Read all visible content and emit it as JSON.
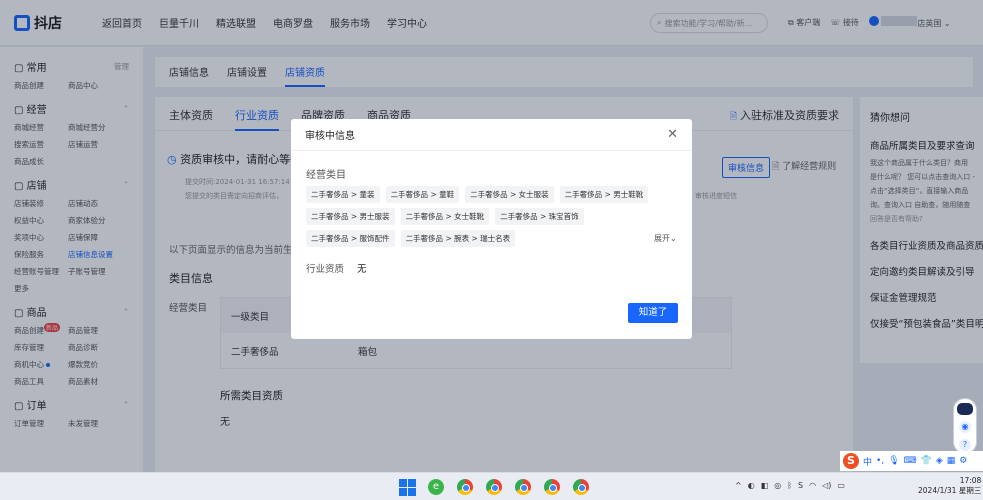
{
  "topbar": {
    "logo": "抖店",
    "nav": [
      "返回首页",
      "巨量千川",
      "精选联盟",
      "电商罗盘",
      "服务市场",
      "学习中心"
    ],
    "search_placeholder": "搜索功能/学习/帮助/新...",
    "service": "客户端",
    "help": "接待",
    "user_suffix": "店英国"
  },
  "sidebar": {
    "groups": [
      {
        "title": "常用",
        "extra": "管理",
        "items": [
          "商品创建",
          "商品中心"
        ]
      },
      {
        "title": "经营",
        "extra": "",
        "items": [
          "商城经营",
          "商城经营分",
          "搜索运营",
          "店铺运营",
          "商品成长",
          ""
        ]
      },
      {
        "title": "店铺",
        "extra": "",
        "items": [
          "店铺装修",
          "店铺动态",
          "权益中心",
          "商家体验分",
          "奖项中心",
          "店铺保障",
          "保险服务",
          "店铺信息设置",
          "经营账号管理",
          "子账号管理",
          "更多",
          ""
        ]
      },
      {
        "title": "商品",
        "extra": "",
        "items": [
          "商品创建",
          "商品管理",
          "库存管理",
          "商品诊断",
          "商机中心",
          "爆款竞价",
          "商品工具",
          "商品素材"
        ]
      },
      {
        "title": "订单",
        "extra": "",
        "items": [
          "订单管理",
          "未发管理"
        ]
      }
    ],
    "hot_badge": "新品"
  },
  "tabs1": [
    "店铺信息",
    "店铺设置",
    "店铺资质"
  ],
  "tabs2": [
    "主体资质",
    "行业资质",
    "品牌资质",
    "商品资质"
  ],
  "tabs2_link": "入驻标准及资质要求",
  "notice": {
    "title": "资质审核中，请耐心等待",
    "time": "提交时间:2024-01-31 16:57:14",
    "desc": "您提交的类目需定向招商评估，",
    "desc2": "审核进度短信",
    "btn": "审核信息",
    "rule_link": "了解经营规则"
  },
  "below_text": "以下页面显示的信息为当前生效",
  "category": {
    "section_title": "类目信息",
    "label": "经营类目",
    "headers": [
      "一级类目",
      "",
      "",
      ""
    ],
    "row": [
      "二手奢侈品",
      "箱包",
      "",
      ""
    ],
    "req_title": "所需类目资质",
    "req_value": "无"
  },
  "right_panel": {
    "title": "猜你想问",
    "q1": "商品所属类目及要求查询",
    "q1_desc": [
      "我这个商品属于什么类目？商用",
      "是什么呢？ 您可以点击查询入口 -",
      "点击“选择类目”，直接输入商品",
      "询。查询入口 自助查，随用随查"
    ],
    "helpful": "回答是否有帮助?",
    "links": [
      "各类目行业资质及商品资质",
      "定向邀约类目解读及引导",
      "保证金管理规范",
      "仅接受“预包装食品”类目明细"
    ]
  },
  "modal": {
    "title": "审核中信息",
    "label": "经营类目",
    "chips": [
      "二手奢侈品 > 童装",
      "二手奢侈品 > 童鞋",
      "二手奢侈品 > 女士服装",
      "二手奢侈品 > 男士鞋靴",
      "二手奢侈品 > 男士服装",
      "二手奢侈品 > 女士鞋靴",
      "二手奢侈品 > 珠宝首饰",
      "二手奢侈品 > 服饰配件",
      "二手奢侈品 > 腕表 > 瑞士名表"
    ],
    "expand": "展开",
    "qual_label": "行业资质",
    "qual_value": "无",
    "ok_button": "知道了"
  },
  "ime": {
    "lang": "中"
  },
  "taskbar": {
    "time": "17:08",
    "date": "2024/1/31 星期三"
  }
}
